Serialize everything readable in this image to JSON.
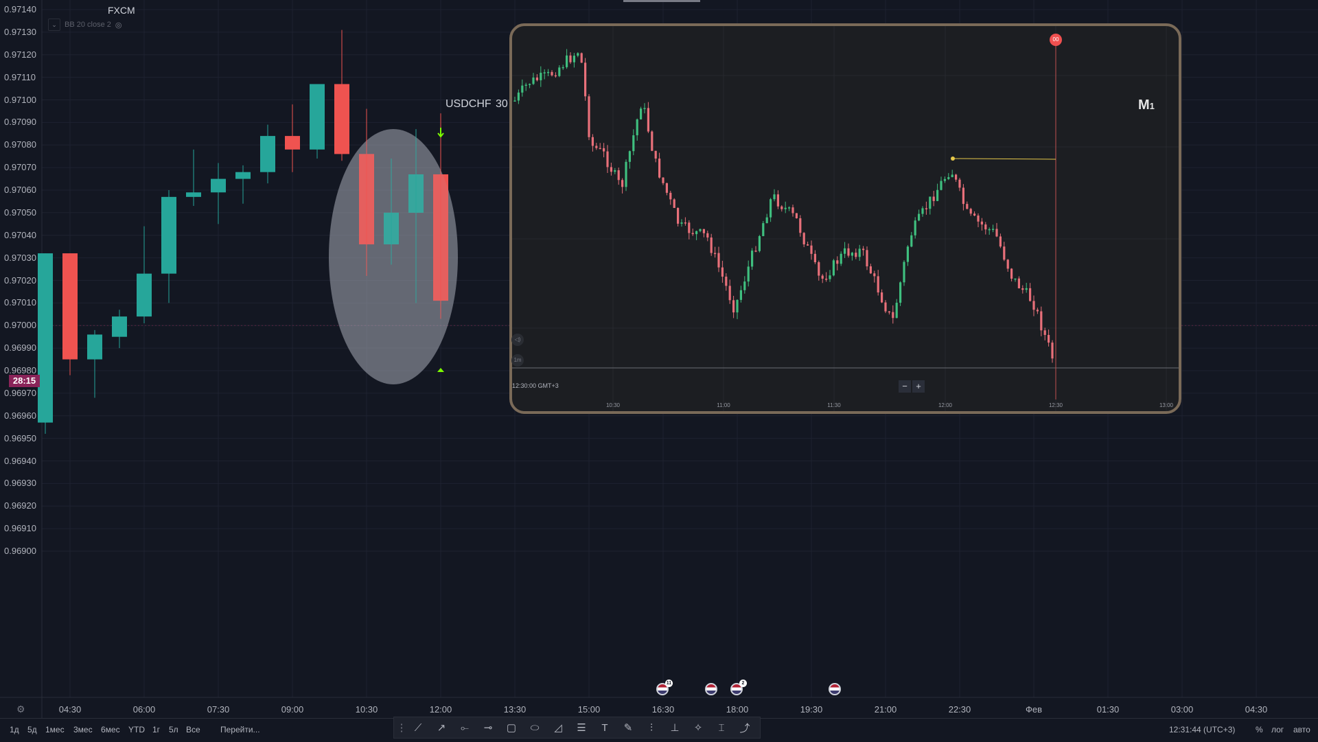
{
  "main_chart": {
    "source": "FXCM",
    "indicator": "BB 20 close 2",
    "symbol": "USDCHF",
    "timeframe": "30",
    "countdown": "28:15",
    "y_labels": [
      "0.97140",
      "0.97130",
      "0.97120",
      "0.97110",
      "0.97100",
      "0.97090",
      "0.97080",
      "0.97070",
      "0.97060",
      "0.97050",
      "0.97040",
      "0.97030",
      "0.97020",
      "0.97010",
      "0.97000",
      "0.96990",
      "0.96980",
      "0.96970",
      "0.96960",
      "0.96950",
      "0.96940",
      "0.96930",
      "0.96920",
      "0.96910",
      "0.96900"
    ],
    "x_labels": [
      "04:30",
      "06:00",
      "07:30",
      "09:00",
      "10:30",
      "12:00",
      "13:30",
      "15:00",
      "16:30",
      "18:00",
      "19:30",
      "21:00",
      "22:30",
      "Фев",
      "01:30",
      "03:00",
      "04:30"
    ],
    "colors": {
      "up": "#26a69a",
      "down": "#ef5350",
      "background": "#131722",
      "grid": "#1e2230",
      "highlight_ellipse": "#a8acb6"
    }
  },
  "chart_data": [
    {
      "type": "candlestick",
      "symbol": "USDCHF",
      "timeframe": "30",
      "source": "FXCM",
      "y_range": [
        0.96895,
        0.97142
      ],
      "x_ticks": [
        "04:30",
        "06:00",
        "07:30",
        "09:00",
        "10:30",
        "12:00"
      ],
      "candles": [
        {
          "t": "04:00",
          "o": 0.96957,
          "h": 0.97032,
          "l": 0.96952,
          "c": 0.97032
        },
        {
          "t": "04:30",
          "o": 0.97032,
          "h": 0.97032,
          "l": 0.96978,
          "c": 0.96985
        },
        {
          "t": "05:00",
          "o": 0.96985,
          "h": 0.96998,
          "l": 0.96968,
          "c": 0.96996
        },
        {
          "t": "05:30",
          "o": 0.96995,
          "h": 0.97007,
          "l": 0.9699,
          "c": 0.97004
        },
        {
          "t": "06:00",
          "o": 0.97004,
          "h": 0.97044,
          "l": 0.97001,
          "c": 0.97023
        },
        {
          "t": "06:30",
          "o": 0.97023,
          "h": 0.9706,
          "l": 0.9701,
          "c": 0.97057
        },
        {
          "t": "07:00",
          "o": 0.97057,
          "h": 0.97078,
          "l": 0.97053,
          "c": 0.97059
        },
        {
          "t": "07:30",
          "o": 0.97059,
          "h": 0.97072,
          "l": 0.97045,
          "c": 0.97065
        },
        {
          "t": "08:00",
          "o": 0.97065,
          "h": 0.97071,
          "l": 0.97054,
          "c": 0.97068
        },
        {
          "t": "08:30",
          "o": 0.97068,
          "h": 0.97089,
          "l": 0.97063,
          "c": 0.97084
        },
        {
          "t": "09:00",
          "o": 0.97084,
          "h": 0.97098,
          "l": 0.97068,
          "c": 0.97078
        },
        {
          "t": "09:30",
          "o": 0.97078,
          "h": 0.97107,
          "l": 0.97074,
          "c": 0.97107
        },
        {
          "t": "10:00",
          "o": 0.97107,
          "h": 0.97131,
          "l": 0.97073,
          "c": 0.97076
        },
        {
          "t": "10:30",
          "o": 0.97076,
          "h": 0.97096,
          "l": 0.97022,
          "c": 0.97036
        },
        {
          "t": "11:00",
          "o": 0.97036,
          "h": 0.97074,
          "l": 0.97027,
          "c": 0.9705
        },
        {
          "t": "11:30",
          "o": 0.9705,
          "h": 0.97087,
          "l": 0.9701,
          "c": 0.97067
        },
        {
          "t": "12:00",
          "o": 0.97067,
          "h": 0.97094,
          "l": 0.97003,
          "c": 0.97011
        }
      ]
    },
    {
      "type": "candlestick",
      "timeframe": "M1",
      "x_ticks": [
        "10:30",
        "11:00",
        "11:30",
        "12:00",
        "12:30",
        "13:00"
      ],
      "cursor_time": "12:30:00 GMT+3",
      "description": "1-minute inset chart zoomed on the last 30-minute candle"
    }
  ],
  "inset": {
    "timeframe": "M",
    "timeframe_sub": "1",
    "cursor_time": "12:30:00 GMT+3",
    "x_labels": [
      "10:30",
      "11:00",
      "11:30",
      "12:00",
      "12:30",
      "13:00"
    ],
    "zoom_out": "−",
    "zoom_in": "+",
    "side_btn_1": "◁)",
    "side_btn_2": "1m",
    "event_marker": "00"
  },
  "events": [
    {
      "badge": "11"
    },
    {
      "badge": ""
    },
    {
      "badge": "2"
    },
    {
      "badge": ""
    }
  ],
  "bottom": {
    "ranges": [
      "1д",
      "5д",
      "1мес",
      "3мес",
      "6мес",
      "YTD",
      "1г",
      "5л",
      "Все"
    ],
    "goto": "Перейти...",
    "clock": "12:31:44 (UTC+3)",
    "percent": "%",
    "log": "лог",
    "auto": "авто"
  }
}
